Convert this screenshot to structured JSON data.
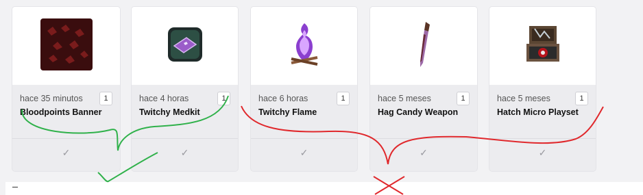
{
  "items": [
    {
      "time": "hace 35 minutos",
      "qty": "1",
      "name": "Bloodpoints Banner",
      "icon": "bloodpoints-banner-icon",
      "check": "✓"
    },
    {
      "time": "hace 4 horas",
      "qty": "1",
      "name": "Twitchy Medkit",
      "icon": "twitchy-medkit-icon",
      "check": "✓"
    },
    {
      "time": "hace 6 horas",
      "qty": "1",
      "name": "Twitchy Flame",
      "icon": "twitchy-flame-icon",
      "check": "✓"
    },
    {
      "time": "hace 5 meses",
      "qty": "1",
      "name": "Hag Candy Weapon",
      "icon": "hag-candy-weapon-icon",
      "check": "✓"
    },
    {
      "time": "hace 5 meses",
      "qty": "1",
      "name": "Hatch Micro Playset",
      "icon": "hatch-micro-playset-icon",
      "check": "✓"
    }
  ],
  "colors": {
    "annotation_green": "#2fb14a",
    "annotation_red": "#e0282c"
  }
}
